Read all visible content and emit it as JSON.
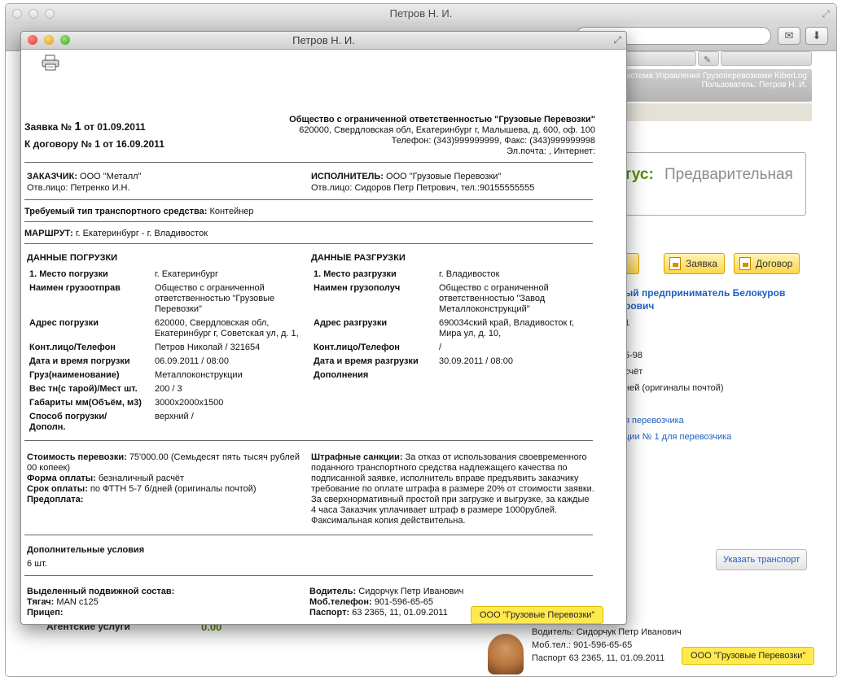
{
  "bg_window": {
    "title": "Петров Н. И.",
    "header_line1": "Система Управления Грузоперевозками KiberLog",
    "header_line2": "Пользователь: Петров Н. И.",
    "status_label": "тус:",
    "status_value": "Предварительная",
    "btn_partial": "ть",
    "btn_zayavka": "Заявка",
    "btn_dogovor": "Договор",
    "entrepreneur_line1": "ый предприниматель Белокуров",
    "entrepreneur_line2": "рович",
    "frag_1": "1",
    "frag_phone": "5-98",
    "frag_schet": "счёт",
    "frag_originals": "ней (оригиналы почтой)",
    "link_carrier": "я перевозчика",
    "link_carrier_no1": "ции № 1 для перевозчика",
    "btn_transport": "Указать транспорт",
    "left_text": "Агентские услуги",
    "left_num": "0.00",
    "driver_line1": "Водитель: Сидорчук Петр Иванович",
    "driver_line2": "Моб.тел.: 901-596-65-65",
    "driver_line3": "Паспорт 63 2365, 11, 01.09.2011",
    "company_badge": "ООО \"Грузовые Перевозки\""
  },
  "popup": {
    "title": "Петров Н. И.",
    "zayavka_prefix": "Заявка №",
    "zayavka_num": "1",
    "zayavka_date": "от 01.09.2011",
    "dogovor": "К договору № 1 от 16.09.2011",
    "org_name": "Общество с ограниченной ответственностью \"Грузовые Перевозки\"",
    "org_address": "620000, Свердловская обл, Екатеринбург г, Малышева, д. 600, оф. 100",
    "org_phone": "Телефон: (343)999999999, Факс: (343)999999998",
    "org_email": "Эл.почта: , Интернет:",
    "customer_label": "ЗАКАЗЧИК:",
    "customer_value": "ООО \"Металл\"",
    "customer_contact": "Отв.лицо: Петренко И.Н.",
    "executor_label": "ИСПОЛНИТЕЛЬ:",
    "executor_value": "ООО \"Грузовые Перевозки\"",
    "executor_contact": "Отв.лицо: Сидоров Петр Петрович, тел.:90155555555",
    "transport_type_label": "Требуемый тип транспортного средства:",
    "transport_type_value": "Контейнер",
    "route_label": "МАРШРУТ:",
    "route_value": "г. Екатеринбург - г. Владивосток",
    "loading_title": "ДАННЫЕ ПОГРУЗКИ",
    "unloading_title": "ДАННЫЕ РАЗГРУЗКИ",
    "loading": {
      "place_label": "1. Место погрузки",
      "place_value": "г. Екатеринбург",
      "shipper_label": "Наимен грузоотправ",
      "shipper_l1": "Общество с ограниченной",
      "shipper_l2": "ответственностью \"Грузовые",
      "shipper_l3": "Перевозки\"",
      "addr_label": "Адрес погрузки",
      "addr_l1": "620000, Свердловская обл,",
      "addr_l2": "Екатеринбург г, Советская ул, д. 1,",
      "contact_label": "Конт.лицо/Телефон",
      "contact_value": "Петров Николай / 321654",
      "date_label": "Дата и время погрузки",
      "date_value": "06.09.2011 / 08:00",
      "cargo_label": "Груз(наименование)",
      "cargo_value": "Металлоконструкции",
      "weight_label": "Вес тн(с тарой)/Мест шт.",
      "weight_value": "200 / 3",
      "dims_label": "Габариты мм(Объём, м3)",
      "dims_value": "3000х2000х1500",
      "method_label_l1": "Способ погрузки/",
      "method_label_l2": "Дополн.",
      "method_value": "верхний /"
    },
    "unloading": {
      "place_label": "1. Место разгрузки",
      "place_value": "г. Владивосток",
      "consignee_label": "Наимен грузополуч",
      "consignee_l1": "Общество с ограниченной",
      "consignee_l2": "ответственностью \"Завод",
      "consignee_l3": "Металлоконструкций\"",
      "addr_label": "Адрес разгрузки",
      "addr_l1": "690034ский край, Владивосток г,",
      "addr_l2": "Мира ул, д. 10,",
      "contact_label": "Конт.лицо/Телефон",
      "contact_value": "/",
      "date_label": "Дата и время разгрузки",
      "date_value": "30.09.2011 / 08:00",
      "extra_label": "Дополнения"
    },
    "cost_label": "Стоимость перевозки:",
    "cost_value_l1": "75'000.00 (Семьдесят пять тысяч рублей",
    "cost_value_l2": "00 копеек)",
    "payment_form_label": "Форма оплаты:",
    "payment_form_value": "безналичный расчёт",
    "payment_term_label": "Срок оплаты:",
    "payment_term_value": "по ФТТН 5-7 б/дней (оригиналы почтой)",
    "prepay_label": "Предоплата:",
    "penalty_label": "Штрафные санкции:",
    "penalty_l1": "За отказ от использования своевременного",
    "penalty_l2": "поданного транспортного средства надлежащего качества по",
    "penalty_l3": "подписанной заявке, исполнитель вправе предъявить заказчику",
    "penalty_l4": "требование по оплате штрафа в размере 20% от стоимости заявки.",
    "penalty_l5": "За сверхнормативный простой при загрузке и выгрузке, за каждые",
    "penalty_l6": "4 часа Заказчик уплачивает штраф в размере 1000рублей.",
    "penalty_l7": "Факсимальная копия действительна.",
    "extra_title": "Дополнительные условия",
    "extra_value": "6 шт.",
    "rolling_label": "Выделенный подвижной состав:",
    "tractor_label": "Тягач:",
    "tractor_value": "MAN c125",
    "trailer_label": "Прицеп:",
    "driver_label": "Водитель:",
    "driver_value": "Сидорчук Петр Иванович",
    "mobile_label": "Моб.телефон:",
    "mobile_value": "901-596-65-65",
    "passport_label": "Паспорт:",
    "passport_value": "63 2365, 11, 01.09.2011",
    "company_badge": "ООО \"Грузовые Перевозки\""
  }
}
